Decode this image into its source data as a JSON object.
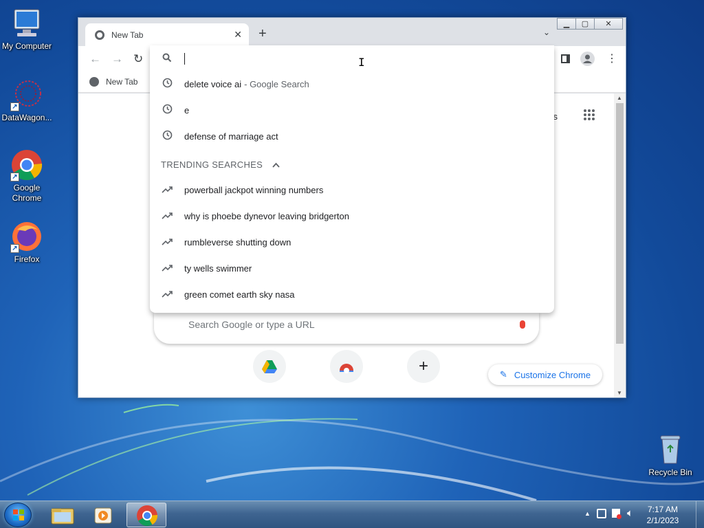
{
  "desktop": {
    "icons": [
      {
        "label": "My Computer"
      },
      {
        "label": "DataWagon..."
      },
      {
        "label": "Google Chrome"
      },
      {
        "label": "Firefox"
      },
      {
        "label": "Recycle Bin"
      }
    ]
  },
  "browser": {
    "tab_title": "New Tab",
    "bookmark_label": "New Tab",
    "apps_partial_text": "ges",
    "ntp_search_placeholder": "Search Google or type a URL",
    "customize_label": "Customize Chrome"
  },
  "omnibox": {
    "history": [
      {
        "text": "delete voice ai",
        "suffix": "- Google Search"
      },
      {
        "text": "e",
        "suffix": ""
      },
      {
        "text": "defense of marriage act",
        "suffix": ""
      }
    ],
    "trending_heading": "TRENDING SEARCHES",
    "trending": [
      {
        "text": "powerball jackpot winning numbers"
      },
      {
        "text": "why is phoebe dynevor leaving bridgerton"
      },
      {
        "text": "rumbleverse shutting down"
      },
      {
        "text": "ty wells swimmer"
      },
      {
        "text": "green comet earth sky nasa"
      }
    ]
  },
  "taskbar": {
    "time": "7:17 AM",
    "date": "2/1/2023"
  }
}
